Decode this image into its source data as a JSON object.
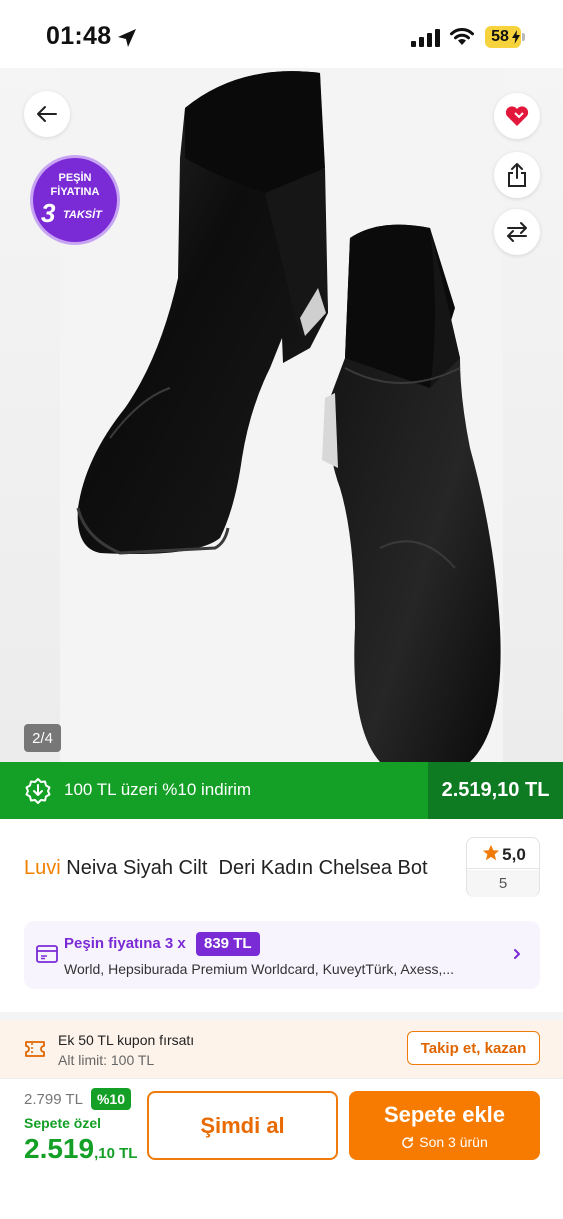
{
  "status_bar": {
    "time": "01:48",
    "battery": "58"
  },
  "gallery": {
    "page_counter": "2/4",
    "badge": {
      "line1": "PEŞİN",
      "line2": "FİYATINA",
      "number": "3",
      "line3": "TAKSİT"
    }
  },
  "promo": {
    "text": "100 TL üzeri %10 indirim",
    "price": "2.519,10 TL"
  },
  "product": {
    "brand": "Luvi",
    "name": "Neiva Siyah Cilt  Deri Kadın Chelsea Bot",
    "rating": "5,0",
    "review_count": "5"
  },
  "installment": {
    "title": "Peşin fiyatına 3 x",
    "amount": "839 TL",
    "banks": "World, Hepsiburada Premium Worldcard, KuveytTürk, Axess,..."
  },
  "coupon": {
    "title": "Ek 50 TL kupon fırsatı",
    "subtitle": "Alt limit: 100 TL",
    "button": "Takip et, kazan"
  },
  "purchase": {
    "old_price": "2.799 TL",
    "discount": "%10",
    "basket_label": "Sepete özel",
    "price_main": "2.519",
    "price_decimal": ",10 TL",
    "buy_now": "Şimdi al",
    "add_to_cart": "Sepete ekle",
    "stock_note": "Son 3 ürün"
  },
  "colors": {
    "brand_orange": "#f77b00",
    "promo_green": "#14a027",
    "installment_purple": "#7a2bd6"
  },
  "icons": [
    "location-arrow-icon",
    "signal-icon",
    "wifi-icon",
    "battery-icon",
    "back-arrow-icon",
    "heart-icon",
    "share-icon",
    "compare-icon",
    "discount-icon",
    "star-icon",
    "card-icon",
    "chevron-right-icon",
    "ticket-icon",
    "refresh-icon"
  ]
}
